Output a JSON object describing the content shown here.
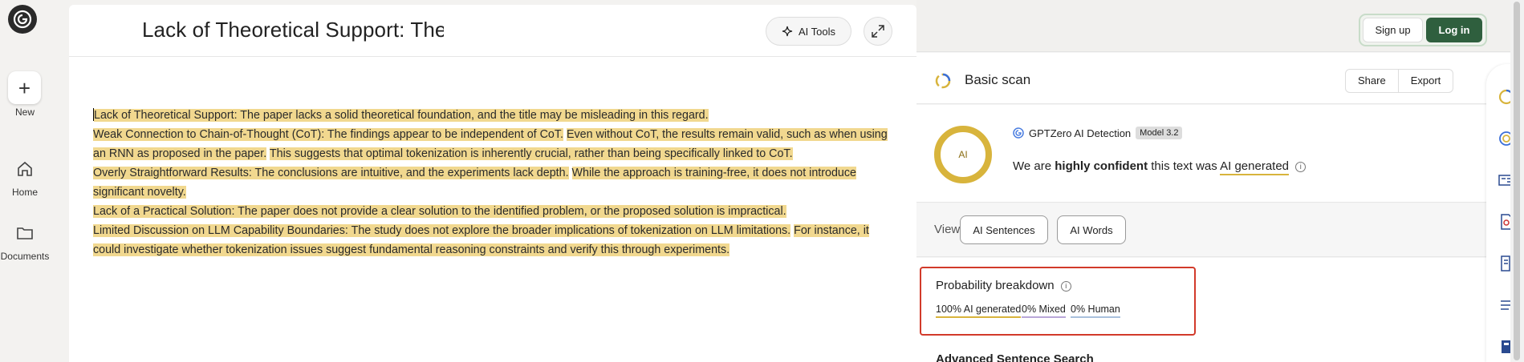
{
  "rail": {
    "new_label": "New",
    "home_label": "Home",
    "documents_label": "Documents"
  },
  "editor": {
    "title": "Lack of Theoretical Support: The",
    "ai_tools_label": "AI Tools",
    "paragraphs": [
      [
        [
          "Lack of Theoretical Support: The paper lacks a solid theoretical foundation, and the title may be misleading in this regard.",
          true
        ]
      ],
      [
        [
          "Weak Connection to Chain-of-Thought (CoT): The findings appear to be independent of CoT.",
          true
        ],
        [
          " ",
          false
        ],
        [
          "Even without CoT, the results remain valid, such as when using an RNN as proposed in the paper.",
          true
        ],
        [
          " ",
          false
        ],
        [
          "This suggests that optimal tokenization is inherently crucial, rather than being specifically linked to CoT.",
          true
        ]
      ],
      [
        [
          "Overly Straightforward Results: The conclusions are intuitive, and the experiments lack depth.",
          true
        ],
        [
          " ",
          false
        ],
        [
          "While the approach is training-free, it does not introduce significant novelty.",
          true
        ]
      ],
      [
        [
          "Lack of a Practical Solution: The paper does not provide a clear solution to the identified problem, or the proposed solution is impractical.",
          true
        ]
      ],
      [
        [
          "Limited Discussion on LLM Capability Boundaries: The study does not explore the broader implications of tokenization on LLM limitations.",
          true
        ],
        [
          " ",
          false
        ],
        [
          "For instance, it could investigate whether tokenization issues suggest fundamental reasoning constraints and verify this through experiments.",
          true
        ]
      ]
    ]
  },
  "auth": {
    "signup_label": "Sign up",
    "login_label": "Log in"
  },
  "scan": {
    "title": "Basic scan",
    "share_label": "Share",
    "export_label": "Export"
  },
  "result": {
    "ring_label": "AI",
    "detector_name": "GPTZero AI Detection",
    "model_badge": "Model 3.2",
    "verdict_prefix": "We are",
    "verdict_confidence": "highly confident",
    "verdict_middle": "this text was",
    "verdict_class": "AI generated"
  },
  "view": {
    "label": "View",
    "sentences_label": "AI Sentences",
    "words_label": "AI Words"
  },
  "probability": {
    "title": "Probability breakdown",
    "ai_label": "100% AI generated",
    "mixed_label": "0% Mixed",
    "human_label": "0% Human",
    "ai_fraction": 1.0,
    "mixed_fraction": 0.0,
    "human_fraction": 0.0
  },
  "advanced": {
    "title": "Advanced Sentence Search"
  },
  "colors": {
    "highlight": "#f1d88f",
    "ai_accent": "#d8b43c",
    "login_bg": "#2f5f3e",
    "callout_border": "#d23a2a"
  }
}
